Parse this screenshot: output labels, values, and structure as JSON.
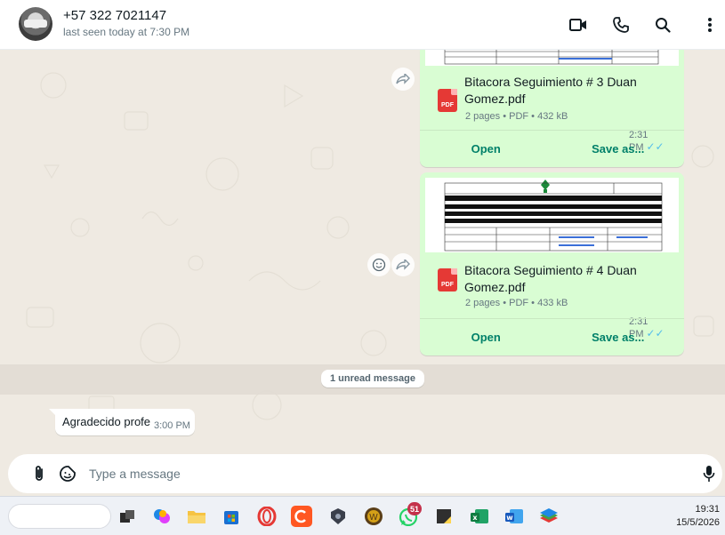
{
  "contact": {
    "name": "+57 322 7021147",
    "status": "last seen today at 7:30 PM"
  },
  "header_icons": [
    "video-call-icon",
    "voice-call-icon",
    "search-icon",
    "more-options-icon"
  ],
  "messages": [
    {
      "type": "document",
      "filename": "Bitacora Seguimiento # 3 Duan Gomez.pdf",
      "meta": "2 pages • PDF • 432 kB",
      "time": "2:31 PM",
      "pdf_label": "PDF",
      "open_label": "Open",
      "save_label": "Save as..."
    },
    {
      "type": "document",
      "filename": "Bitacora Seguimiento # 4 Duan Gomez.pdf",
      "meta": "2 pages • PDF • 433 kB",
      "time": "2:31 PM",
      "pdf_label": "PDF",
      "open_label": "Open",
      "save_label": "Save as..."
    }
  ],
  "unread_label": "1 unread message",
  "incoming": {
    "text": "Agradecido profe",
    "time": "3:00 PM"
  },
  "composer": {
    "placeholder": "Type a message"
  },
  "taskbar": {
    "badge": "51",
    "time": "19:31",
    "date": "15/5/2026"
  },
  "colors": {
    "outgoing_bubble": "#d9fdd3",
    "accent": "#008069",
    "read_ticks": "#53bdeb",
    "chat_background": "#efeae2"
  }
}
